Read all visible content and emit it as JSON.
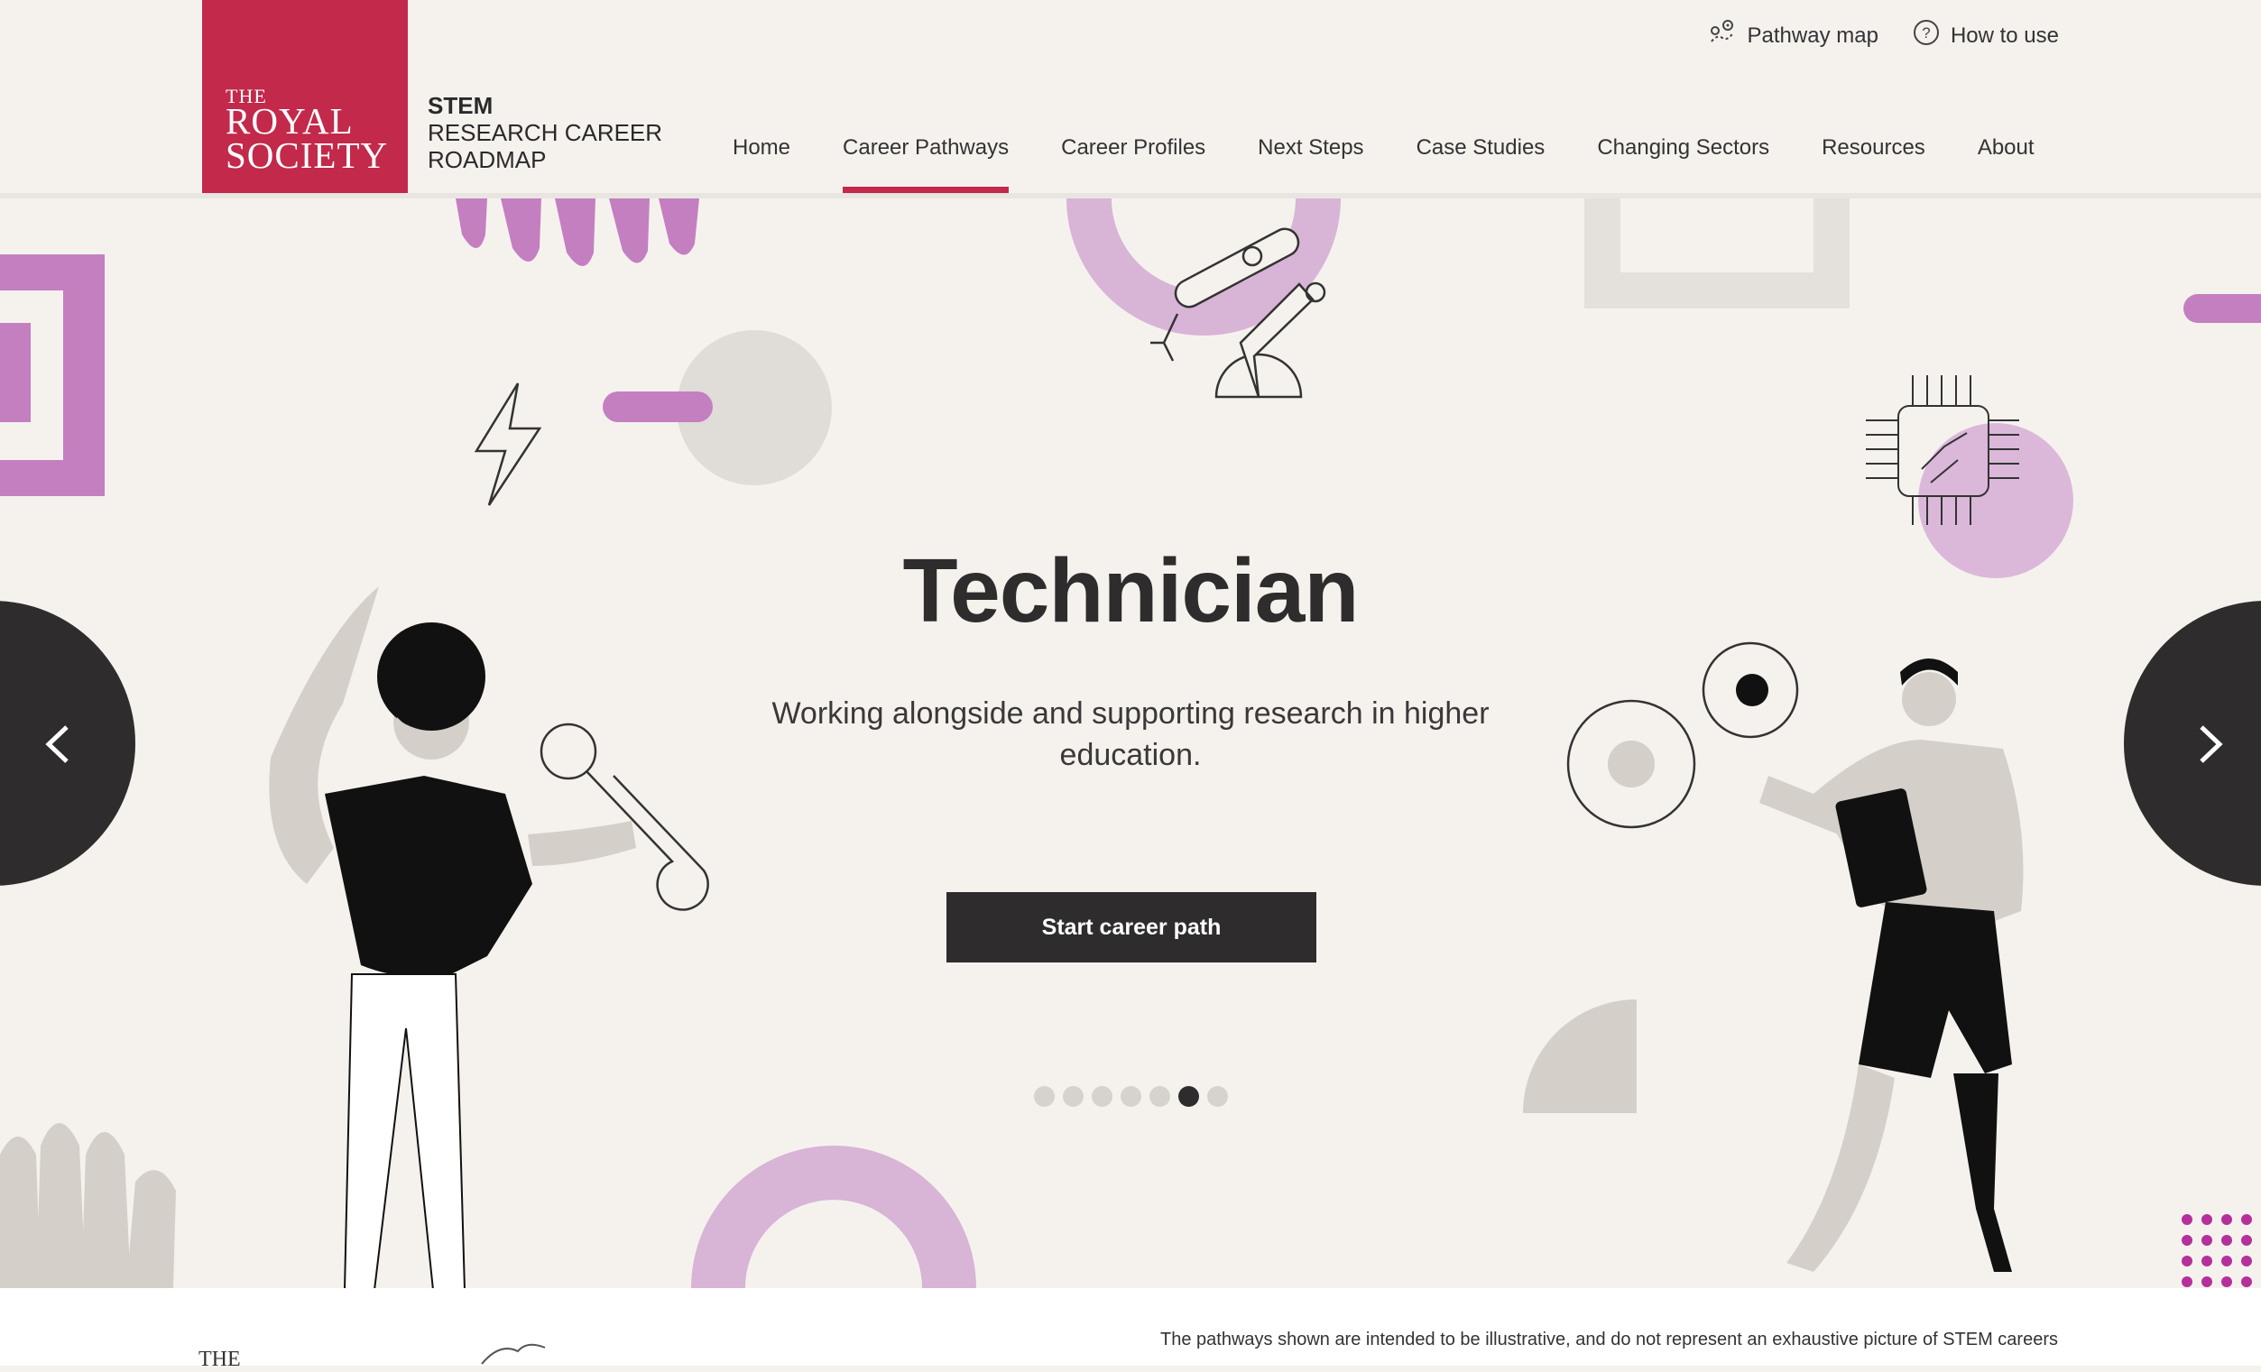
{
  "header": {
    "logo": {
      "the": "THE",
      "royal": "ROYAL",
      "society": "SOCIETY"
    },
    "site_title": {
      "line1": "STEM",
      "line2": "RESEARCH CAREER",
      "line3": "ROADMAP"
    },
    "utility_links": [
      {
        "label": "Pathway map",
        "icon": "map-pin-icon"
      },
      {
        "label": "How to use",
        "icon": "question-circle-icon"
      }
    ],
    "nav": [
      {
        "label": "Home"
      },
      {
        "label": "Career Pathways",
        "active": true
      },
      {
        "label": "Career Profiles"
      },
      {
        "label": "Next Steps"
      },
      {
        "label": "Case Studies"
      },
      {
        "label": "Changing Sectors"
      },
      {
        "label": "Resources"
      },
      {
        "label": "About"
      }
    ]
  },
  "hero": {
    "title": "Technician",
    "description": "Working alongside and supporting research in higher education.",
    "cta_label": "Start career path",
    "slides_total": 7,
    "active_slide": 6
  },
  "footer": {
    "logo_text": "THE",
    "note": "The pathways shown are intended to be illustrative, and do not represent an exhaustive picture of STEM careers"
  },
  "colors": {
    "brand": "#c2294a",
    "dark": "#2e2c2c",
    "background": "#f5f2ee",
    "accent_purple": "#c47fc1",
    "accent_lilac": "#d8b4d6",
    "neutral": "#d4cfc8"
  }
}
